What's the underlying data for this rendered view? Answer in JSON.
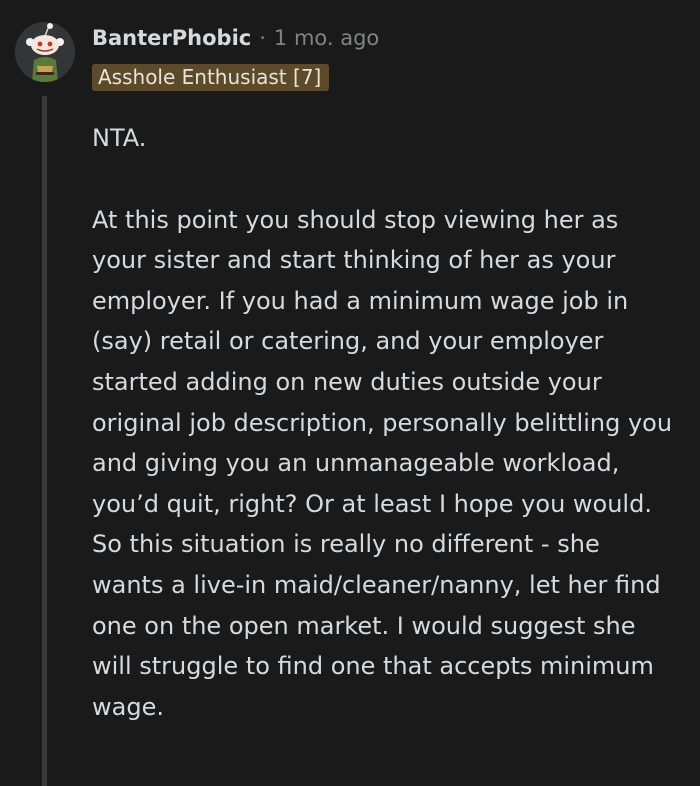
{
  "comment": {
    "username": "BanterPhobic",
    "separator": "·",
    "timestamp": "1 mo. ago",
    "flair": "Asshole Enthusiast [7]",
    "avatar_icon": "snoo-avatar-icon",
    "paragraphs": [
      "NTA.",
      "At this point you should stop viewing her as your sister and start thinking of her as your employer. If you had a minimum wage job in (say) retail or catering, and your employer started adding on new duties outside your original job description, personally belittling you and giving you an unmanageable workload, you’d quit, right? Or at least I hope you would. So this situation is really no different - she wants a live-in maid/cleaner/nanny, let her find one on the open market. I would suggest she will struggle to find one that accepts minimum wage."
    ]
  },
  "colors": {
    "background": "#1a1a1b",
    "text": "#d7dadc",
    "muted": "#818384",
    "flair_bg": "#5c4a2b",
    "thread_line": "#3a3a3c"
  }
}
